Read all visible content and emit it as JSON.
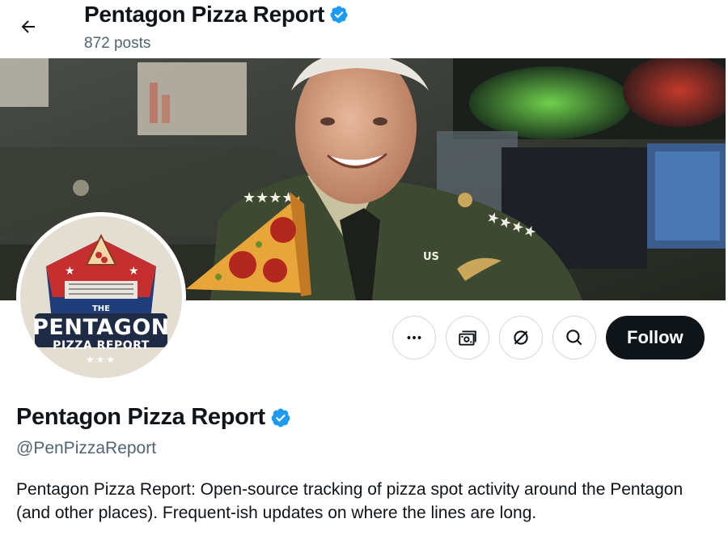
{
  "header": {
    "title": "Pentagon Pizza Report",
    "posts_count": "872 posts"
  },
  "avatar": {
    "logo_the": "THE",
    "logo_main": "PENTAGON",
    "logo_sub": "PIZZA REPORT",
    "logo_stars": "★★★"
  },
  "profile": {
    "display_name": "Pentagon Pizza Report",
    "handle": "@PenPizzaReport",
    "bio": "Pentagon Pizza Report: Open-source tracking of pizza spot activity around the Pentagon (and other places). Frequent-ish updates on where the lines are long."
  },
  "actions": {
    "follow_label": "Follow",
    "buttons": [
      "more-icon",
      "subscriptions-icon",
      "grok-icon",
      "search-icon"
    ]
  },
  "banner": {
    "uniform_tag": "US"
  },
  "colors": {
    "verified": "#1d9bf0",
    "follow_bg": "#0f1419",
    "secondary_text": "#536471"
  }
}
